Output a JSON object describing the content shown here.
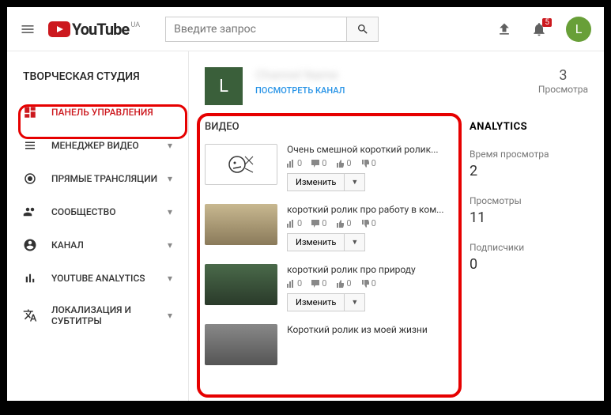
{
  "header": {
    "logo_text": "YouTube",
    "logo_sup": "UA",
    "search_placeholder": "Введите запрос",
    "bell_badge": "5",
    "avatar_letter": "L"
  },
  "sidebar": {
    "title": "ТВОРЧЕСКАЯ СТУДИЯ",
    "items": [
      {
        "label": "ПАНЕЛЬ УПРАВЛЕНИЯ"
      },
      {
        "label": "МЕНЕДЖЕР ВИДЕО"
      },
      {
        "label": "ПРЯМЫЕ ТРАНСЛЯЦИИ"
      },
      {
        "label": "СООБЩЕСТВО"
      },
      {
        "label": "КАНАЛ"
      },
      {
        "label": "YOUTUBE ANALYTICS"
      },
      {
        "label": "ЛОКАЛИЗАЦИЯ И СУБТИТРЫ"
      }
    ]
  },
  "channel": {
    "avatar_letter": "L",
    "view_channel": "ПОСМОТРЕТЬ КАНАЛ",
    "views_count": "3",
    "views_label": "Просмотра"
  },
  "videos_panel": {
    "title": "ВИДЕО",
    "edit_label": "Изменить",
    "items": [
      {
        "title": "Очень смешной короткий ролик...",
        "bars": "0",
        "comments": "0",
        "likes": "0",
        "dislikes": "0"
      },
      {
        "title": "короткий ролик про работу в ком...",
        "bars": "0",
        "comments": "0",
        "likes": "0",
        "dislikes": "0"
      },
      {
        "title": "короткий ролик про природу",
        "bars": "0",
        "comments": "0",
        "likes": "0",
        "dislikes": "0"
      },
      {
        "title": "Короткий ролик из моей жизни",
        "bars": "",
        "comments": "",
        "likes": "",
        "dislikes": ""
      }
    ]
  },
  "analytics": {
    "title": "ANALYTICS",
    "items": [
      {
        "label": "Время просмотра",
        "value": "2"
      },
      {
        "label": "Просмотры",
        "value": "11"
      },
      {
        "label": "Подписчики",
        "value": "0"
      }
    ]
  }
}
